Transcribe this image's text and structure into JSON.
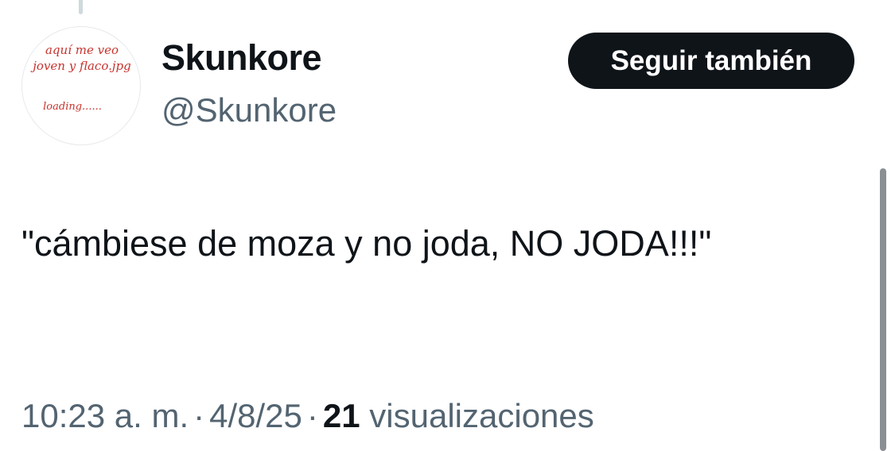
{
  "avatar": {
    "line1": "aquí me veo",
    "line2": "joven y flaco.jpg",
    "line3": "loading......"
  },
  "author": {
    "display_name": "Skunkore",
    "handle": "@Skunkore"
  },
  "follow_button": {
    "label": "Seguir también"
  },
  "tweet": {
    "text": "\"cámbiese de moza y no joda, NO JODA!!!\"",
    "time": "10:23 a. m.",
    "separator": "·",
    "date": "4/8/25",
    "views_count": "21",
    "views_label": "visualizaciones"
  },
  "colors": {
    "text_primary": "#0f1419",
    "text_secondary": "#536471",
    "button_bg": "#0f1419",
    "avatar_text": "#c8332e"
  }
}
